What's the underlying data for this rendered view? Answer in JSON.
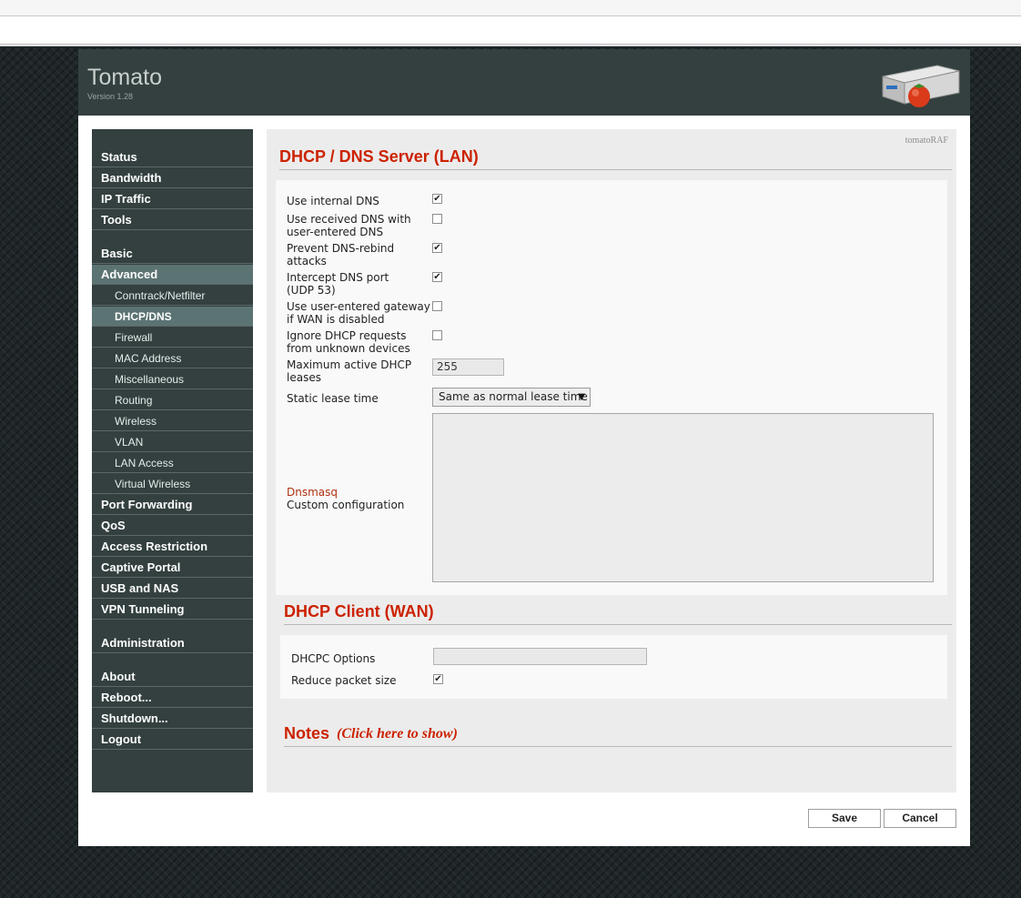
{
  "app": {
    "title": "Tomato",
    "version": "Version 1.28",
    "user_tag": "tomatoRAF"
  },
  "sidebar": {
    "items": [
      {
        "label": "Status"
      },
      {
        "label": "Bandwidth"
      },
      {
        "label": "IP Traffic"
      },
      {
        "label": "Tools"
      },
      {
        "label": "Basic"
      },
      {
        "label": "Advanced"
      },
      {
        "label": "Conntrack/Netfilter"
      },
      {
        "label": "DHCP/DNS"
      },
      {
        "label": "Firewall"
      },
      {
        "label": "MAC Address"
      },
      {
        "label": "Miscellaneous"
      },
      {
        "label": "Routing"
      },
      {
        "label": "Wireless"
      },
      {
        "label": "VLAN"
      },
      {
        "label": "LAN Access"
      },
      {
        "label": "Virtual Wireless"
      },
      {
        "label": "Port Forwarding"
      },
      {
        "label": "QoS"
      },
      {
        "label": "Access Restriction"
      },
      {
        "label": "Captive Portal"
      },
      {
        "label": "USB and NAS"
      },
      {
        "label": "VPN Tunneling"
      },
      {
        "label": "Administration"
      },
      {
        "label": "About"
      },
      {
        "label": "Reboot..."
      },
      {
        "label": "Shutdown..."
      },
      {
        "label": "Logout"
      }
    ]
  },
  "lan": {
    "title": "DHCP / DNS Server (LAN)",
    "use_internal_dns": {
      "label": "Use internal DNS",
      "checked": true
    },
    "use_received_dns": {
      "label_1": "Use received DNS with",
      "label_2": "user-entered DNS",
      "checked": false
    },
    "prevent_rebind": {
      "label_1": "Prevent DNS-rebind",
      "label_2": "attacks",
      "checked": true
    },
    "intercept_dns": {
      "label_1": "Intercept DNS port",
      "label_2": "(UDP 53)",
      "checked": true
    },
    "user_gateway": {
      "label_1": "Use user-entered gateway",
      "label_2": "if WAN is disabled",
      "checked": false
    },
    "ignore_dhcp": {
      "label_1": "Ignore DHCP requests",
      "label_2": "from unknown devices",
      "checked": false
    },
    "max_leases": {
      "label_1": "Maximum active DHCP",
      "label_2": "leases",
      "value": "255"
    },
    "static_lease": {
      "label": "Static lease time",
      "selected": "Same as normal lease time"
    },
    "dnsmasq": {
      "link": "Dnsmasq",
      "label": "Custom configuration",
      "value": ""
    }
  },
  "wan": {
    "title": "DHCP Client (WAN)",
    "dhcpc_options": {
      "label": "DHCPC Options",
      "value": ""
    },
    "reduce_packet": {
      "label": "Reduce packet size",
      "checked": true
    }
  },
  "notes": {
    "title": "Notes",
    "link": "(Click here to show)"
  },
  "buttons": {
    "save": "Save",
    "cancel": "Cancel"
  },
  "colors": {
    "accent": "#cc2200",
    "header_bg": "#33403f",
    "sidebar_active": "#5c7373"
  },
  "icons": {
    "checkbox_mark": "✔",
    "dropdown": "▼"
  }
}
